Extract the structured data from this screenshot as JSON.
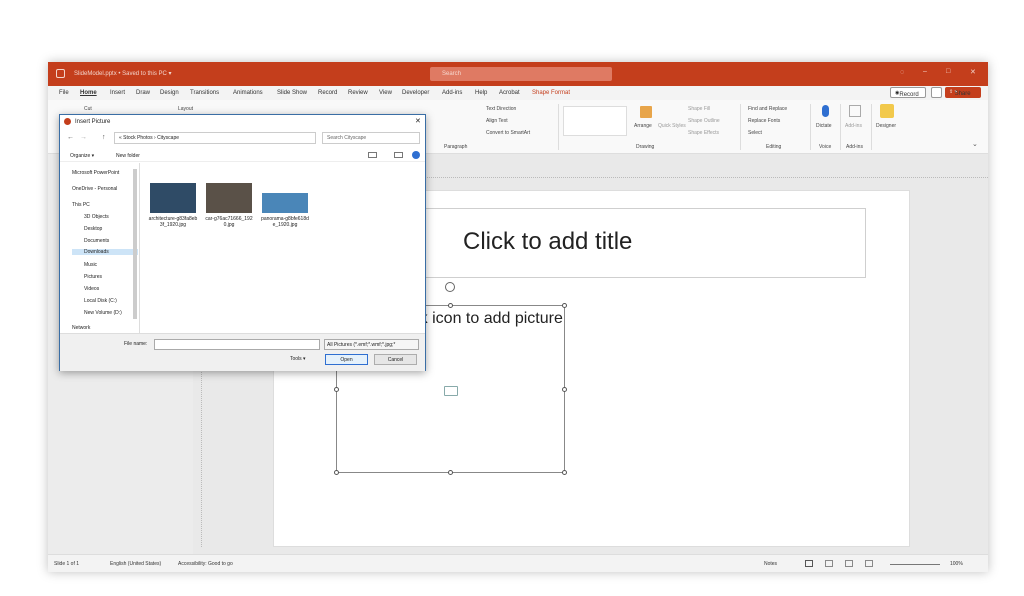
{
  "titlebar": {
    "filename": "SlideModel.pptx • Saved to this PC ▾",
    "search_placeholder": "Search"
  },
  "menu": [
    "File",
    "Home",
    "Insert",
    "Draw",
    "Design",
    "Transitions",
    "Animations",
    "Slide Show",
    "Record",
    "Review",
    "View",
    "Developer",
    "Add-ins",
    "Help",
    "Acrobat",
    "Shape Format"
  ],
  "record_button": "Record",
  "share_button": "Share",
  "ribbon": {
    "cut": "Cut",
    "layout": "Layout",
    "text_direction": "Text Direction",
    "align_text": "Align Text",
    "convert_smartart": "Convert to SmartArt",
    "paragraph": "Paragraph",
    "arrange": "Arrange",
    "quick_styles": "Quick Styles",
    "shape_fill": "Shape Fill",
    "shape_outline": "Shape Outline",
    "shape_effects": "Shape Effects",
    "drawing": "Drawing",
    "find_replace": "Find and Replace",
    "replace_fonts": "Replace Fonts",
    "select": "Select",
    "editing": "Editing",
    "dictate": "Dictate",
    "voice": "Voice",
    "addins_btn": "Add-ins",
    "addins_group": "Add-ins",
    "designer": "Designer"
  },
  "slide": {
    "title_placeholder": "Click to add title",
    "picture_placeholder": "Click icon to add picture"
  },
  "status": {
    "slide": "Slide 1 of 1",
    "language": "English (United States)",
    "accessibility": "Accessibility: Good to go",
    "notes": "Notes",
    "zoom": "100%"
  },
  "dialog": {
    "title": "Insert Picture",
    "breadcrumb": "« Stock Photos › Cityscape",
    "search_placeholder": "Search Cityscape",
    "organize": "Organize ▾",
    "new_folder": "New folder",
    "nav_items": [
      "Microsoft PowerPoint",
      "OneDrive - Personal",
      "This PC",
      "3D Objects",
      "Desktop",
      "Documents",
      "Downloads",
      "Music",
      "Pictures",
      "Videos",
      "Local Disk (C:)",
      "New Volume (D:)",
      "Network"
    ],
    "files": [
      {
        "name": "architecture-g83fa8eb3f_1920.jpg",
        "color": "#2f4b66"
      },
      {
        "name": "car-g76ac71666_1920.jpg",
        "color": "#5a5148"
      },
      {
        "name": "panorama-g8bfe618de_1920.jpg",
        "color": "#4a86b8"
      }
    ],
    "filename_label": "File name:",
    "filename_value": "",
    "filetype": "All Pictures (*.emf;*.wmf;*.jpg;*",
    "tools": "Tools ▾",
    "open": "Open",
    "cancel": "Cancel"
  }
}
